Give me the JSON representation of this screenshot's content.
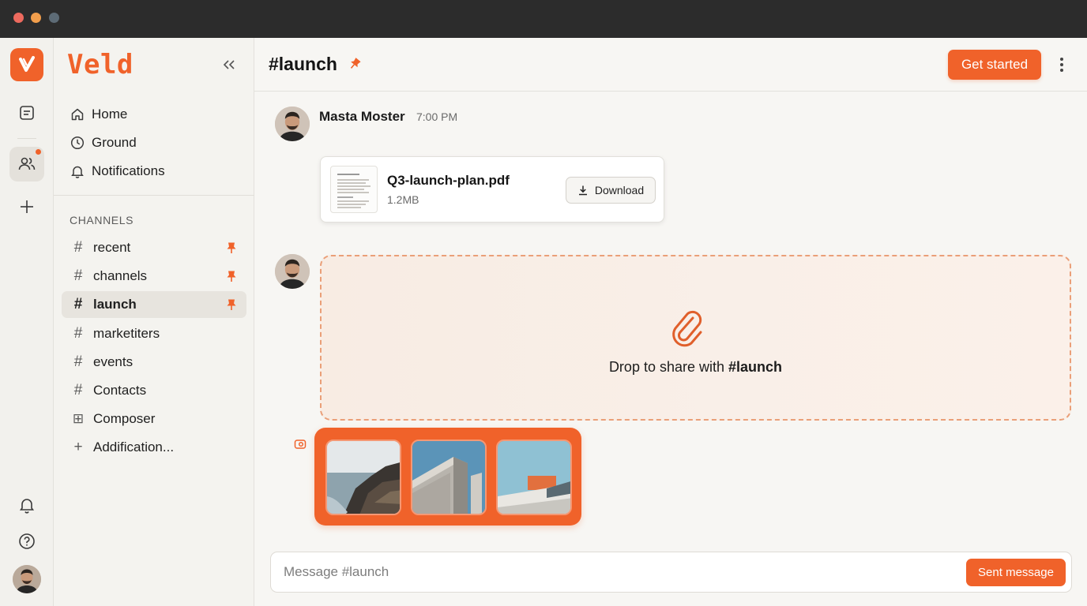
{
  "window": {
    "controls": [
      "close",
      "minimize",
      "zoom"
    ]
  },
  "rail": {
    "logo_icon": "veld-logo-icon",
    "items": [
      {
        "icon": "document-icon"
      },
      {
        "icon": "people-icon",
        "active": true,
        "badge": true
      },
      {
        "icon": "plus-icon"
      }
    ],
    "bottom": [
      {
        "icon": "bell-icon"
      },
      {
        "icon": "help-icon"
      },
      {
        "icon": "user-avatar"
      }
    ]
  },
  "sidebar": {
    "brand": "Veld",
    "nav": [
      {
        "label": "Home",
        "icon": "home-icon"
      },
      {
        "label": "Ground",
        "icon": "clock-icon"
      },
      {
        "label": "Notifications",
        "icon": "bell-icon"
      }
    ],
    "section_label": "CHANNELS",
    "channels": [
      {
        "label": "recent",
        "prefix": "#",
        "pinned": true
      },
      {
        "label": "channels",
        "prefix": "#",
        "pinned": true
      },
      {
        "label": "launch",
        "prefix": "#",
        "pinned": true,
        "active": true
      },
      {
        "label": "marketiters",
        "prefix": "#"
      },
      {
        "label": "events",
        "prefix": "#"
      },
      {
        "label": "Contacts",
        "prefix": "#"
      },
      {
        "label": "Composer",
        "prefix": "⊞"
      },
      {
        "label": "Addification...",
        "prefix": "+"
      }
    ]
  },
  "header": {
    "title": "#launch",
    "cta_label": "Get started"
  },
  "messages": {
    "sender": "Masta Moster",
    "time": "7:00 PM",
    "file": {
      "name": "Q3-launch-plan.pdf",
      "size": "1.2MB",
      "download_label": "Download"
    }
  },
  "dropzone": {
    "text_prefix": "Drop to share with ",
    "text_channel": "#launch"
  },
  "gallery": {
    "images": [
      "coastal-cliff-image",
      "building-facade-image",
      "modern-architecture-image"
    ]
  },
  "composer": {
    "placeholder": "Message #launch",
    "send_label": "Sent message"
  },
  "colors": {
    "accent": "#f0622a",
    "drop_border": "#ea9f78",
    "sidebar_bg": "#f4f3ef",
    "main_bg": "#f7f6f3"
  }
}
